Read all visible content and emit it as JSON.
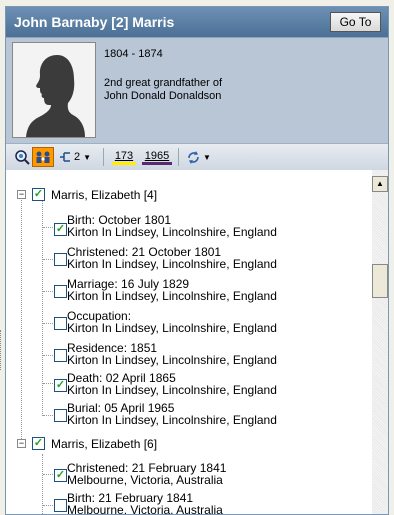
{
  "header": {
    "title": "John Barnaby [2] Marris",
    "goto_label": "Go To"
  },
  "person": {
    "years": "1804 - 1874",
    "relation_line1": "2nd great grandfather of",
    "relation_line2": "John Donald Donaldson"
  },
  "toolbar": {
    "generations": "2",
    "count1": "173",
    "count2": "1965",
    "count1_color": "#ffee00",
    "count2_color": "#5b2a6e"
  },
  "groups": [
    {
      "label": "Marris, Elizabeth [4]",
      "checked": true,
      "facts": [
        {
          "title": "Birth: October 1801",
          "place": "Kirton In Lindsey, Lincolnshire, England",
          "checked": true
        },
        {
          "title": "Christened: 21 October 1801",
          "place": "Kirton In Lindsey, Lincolnshire, England",
          "checked": false
        },
        {
          "title": "Marriage: 16 July 1829",
          "place": "Kirton In Lindsey, Lincolnshire, England",
          "checked": false
        },
        {
          "title": "Occupation:",
          "place": "Kirton In Lindsey, Lincolnshire, England",
          "checked": false
        },
        {
          "title": "Residence: 1851",
          "place": "Kirton In Lindsey, Lincolnshire, England",
          "checked": false
        },
        {
          "title": "Death: 02 April 1865",
          "place": "Kirton In Lindsey, Lincolnshire, England",
          "checked": true
        },
        {
          "title": "Burial: 05 April 1965",
          "place": "Kirton In Lindsey, Lincolnshire, England",
          "checked": false
        }
      ]
    },
    {
      "label": "Marris, Elizabeth [6]",
      "checked": true,
      "facts": [
        {
          "title": "Christened: 21 February 1841",
          "place": "Melbourne, Victoria, Australia",
          "checked": true
        },
        {
          "title": "Birth: 21 February 1841",
          "place": "Melbourne, Victoria, Australia",
          "checked": false
        }
      ]
    }
  ],
  "icons": {
    "find": "magnifier-icon",
    "family": "family-view-icon",
    "tree": "tree-generations-icon",
    "sync": "sync-icon"
  }
}
